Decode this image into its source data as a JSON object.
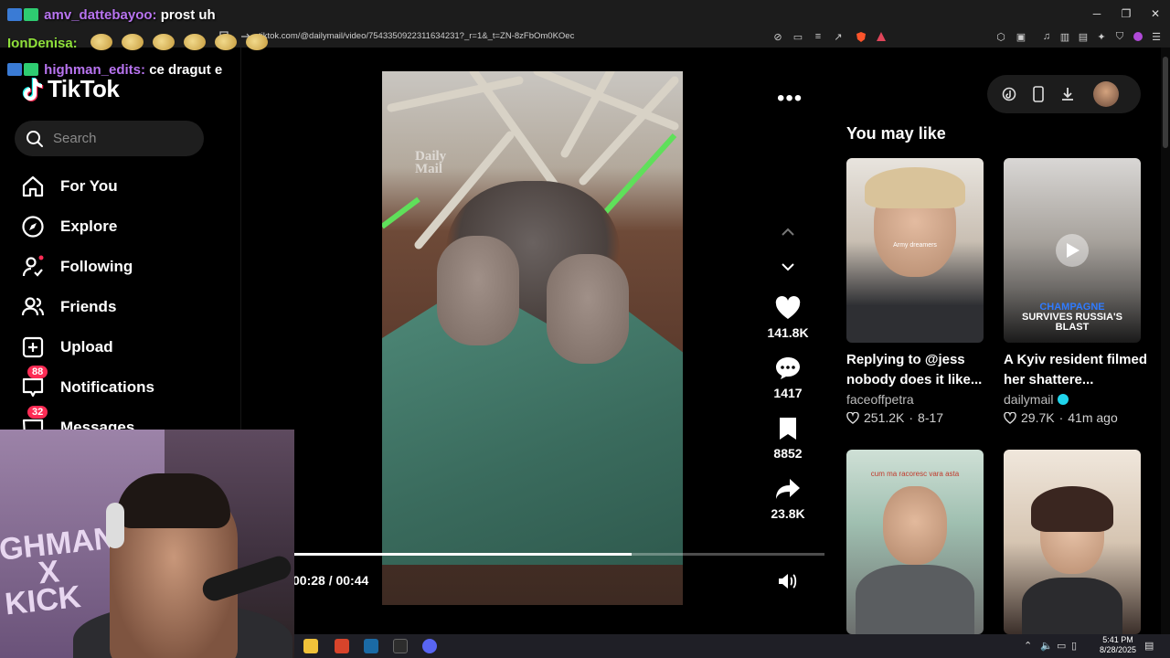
{
  "browser": {
    "url": "tiktok.com/@dailymail/video/7543350922311634231?_r=1&_t=ZN-8zFbOm0KOec",
    "window_controls": {
      "minimize": "─",
      "maximize": "❐",
      "close": "✕"
    }
  },
  "chat": {
    "lines": [
      {
        "user": "amv_dattebayoo:",
        "message": "prost uh",
        "user_color": "#b874f0"
      },
      {
        "user": "IonDenisa:",
        "message": "",
        "user_color": "#8fe03a"
      },
      {
        "user": "highman_edits:",
        "message": "ce dragut e",
        "user_color": "#b874f0"
      }
    ]
  },
  "sidebar": {
    "logo_text": "TikTok",
    "search_placeholder": "Search",
    "items": [
      {
        "label": "For You",
        "icon": "home-icon"
      },
      {
        "label": "Explore",
        "icon": "compass-icon"
      },
      {
        "label": "Following",
        "icon": "following-icon"
      },
      {
        "label": "Friends",
        "icon": "friends-icon"
      },
      {
        "label": "Upload",
        "icon": "upload-icon"
      },
      {
        "label": "Notifications",
        "icon": "inbox-icon",
        "badge": "88"
      },
      {
        "label": "Messages",
        "icon": "message-icon",
        "badge": "32"
      }
    ]
  },
  "video": {
    "watermark_line1": "Daily",
    "watermark_line2": "Mail",
    "likes": "141.8K",
    "comments": "1417",
    "saves": "8852",
    "shares": "23.8K",
    "timecode": "00:28 / 00:44",
    "progress": 0.6364,
    "author": "dailymail"
  },
  "right_panel": {
    "section_title": "You may like",
    "cards": [
      {
        "title": "Replying to @jess  nobody does it like...",
        "author": "faceoffpetra",
        "verified": false,
        "likes": "251.2K",
        "age": "8-17",
        "thumb_text": "Army dreamers"
      },
      {
        "title": "A Kyiv resident filmed her shattere...",
        "author": "dailymail",
        "verified": true,
        "likes": "29.7K",
        "age": "41m ago",
        "thumb_text_1": "CHAMPAGNE",
        "thumb_text_2": "SURVIVES RUSSIA'S",
        "thumb_text_3": "BLAST"
      },
      {
        "title": "",
        "author": "",
        "thumb_text": "cum ma racoresc vara asta"
      },
      {
        "title": "",
        "author": ""
      }
    ]
  },
  "webcam": {
    "poster_text_1": "GHMAN",
    "poster_text_2": "X",
    "poster_text_3": "KICK"
  },
  "taskbar": {
    "time": "5:41 PM",
    "date": "8/28/2025"
  },
  "colors": {
    "accent": "#fe2c55",
    "verified": "#20d5ec"
  }
}
